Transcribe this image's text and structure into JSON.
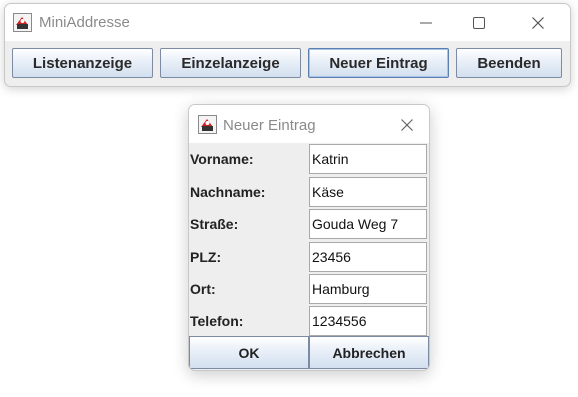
{
  "main_window": {
    "title": "MiniAddresse",
    "icons": {
      "app": "java-app-icon",
      "minimize": "minimize-icon",
      "maximize": "maximize-icon",
      "close": "close-icon"
    },
    "toolbar": {
      "list_view": "Listenanzeige",
      "single_view": "Einzelanzeige",
      "new_entry": "Neuer Eintrag",
      "quit": "Beenden"
    }
  },
  "dialog": {
    "title": "Neuer Eintrag",
    "fields": [
      {
        "label": "Vorname:",
        "value": "Katrin"
      },
      {
        "label": "Nachname:",
        "value": "Käse"
      },
      {
        "label": "Straße:",
        "value": "Gouda Weg 7"
      },
      {
        "label": "PLZ:",
        "value": "23456"
      },
      {
        "label": "Ort:",
        "value": "Hamburg"
      },
      {
        "label": "Telefon:",
        "value": "1234556"
      }
    ],
    "buttons": {
      "ok": "OK",
      "cancel": "Abbrechen"
    }
  },
  "colors": {
    "button_gradient_bottom": "#d3e0ef",
    "button_border": "#7a8ba3",
    "title_text": "#8a8a8a",
    "window_bg": "#eeeeee"
  }
}
